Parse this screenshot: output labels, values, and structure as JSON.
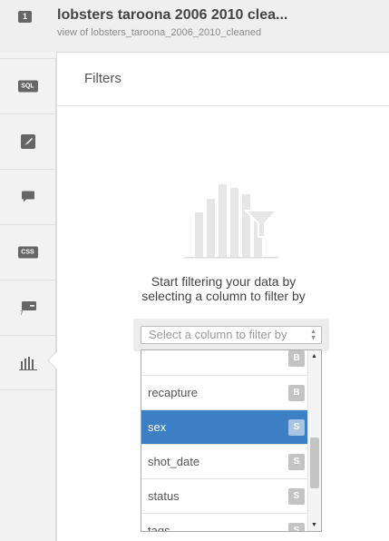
{
  "header": {
    "view_badge": "1",
    "title": "lobsters taroona 2006 2010 clea...",
    "subtitle": "view of lobsters_taroona_2006_2010_cleaned"
  },
  "rail": {
    "sql_label": "SQL",
    "css_label": "CSS"
  },
  "panel": {
    "title": "Filters",
    "empty_line1": "Start filtering your data by",
    "empty_line2": "selecting a column to filter by",
    "select_placeholder": "Select a column to filter by"
  },
  "dropdown": {
    "options": [
      {
        "label": "",
        "type": "B"
      },
      {
        "label": "recapture",
        "type": "B"
      },
      {
        "label": "sex",
        "type": "S",
        "selected": true
      },
      {
        "label": "shot_date",
        "type": "S"
      },
      {
        "label": "status",
        "type": "S"
      },
      {
        "label": "tags",
        "type": "S"
      }
    ]
  },
  "colors": {
    "selected_bg": "#3d7fc4",
    "icon_gray": "#666666"
  }
}
